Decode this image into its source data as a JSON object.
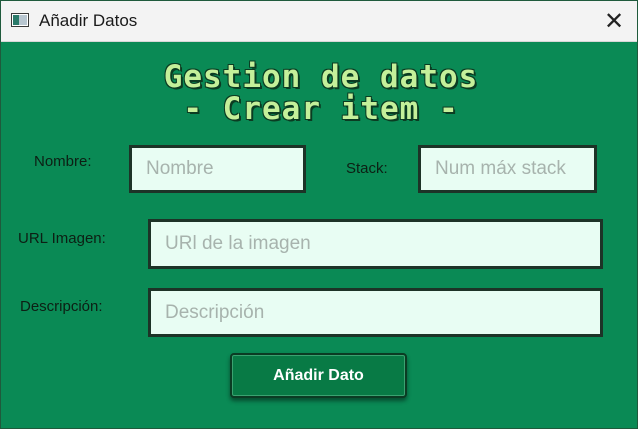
{
  "window": {
    "title": "Añadir Datos",
    "close_glyph": "✕"
  },
  "form": {
    "title_line1": "Gestion de datos",
    "title_line2": "- Crear item -",
    "fields": {
      "nombre": {
        "label": "Nombre:",
        "placeholder": "Nombre",
        "value": ""
      },
      "stack": {
        "label": "Stack:",
        "placeholder": "Num máx stack",
        "value": ""
      },
      "url_imagen": {
        "label": "URL Imagen:",
        "placeholder": "URl de la imagen",
        "value": ""
      },
      "descripcion": {
        "label": "Descripción:",
        "placeholder": "Descripción",
        "value": ""
      }
    },
    "submit_label": "Añadir Dato"
  },
  "colors": {
    "background": "#0a8a55",
    "title_text": "#c4f09a",
    "input_bg": "#e8fdf3",
    "button_bg": "#087a45"
  }
}
